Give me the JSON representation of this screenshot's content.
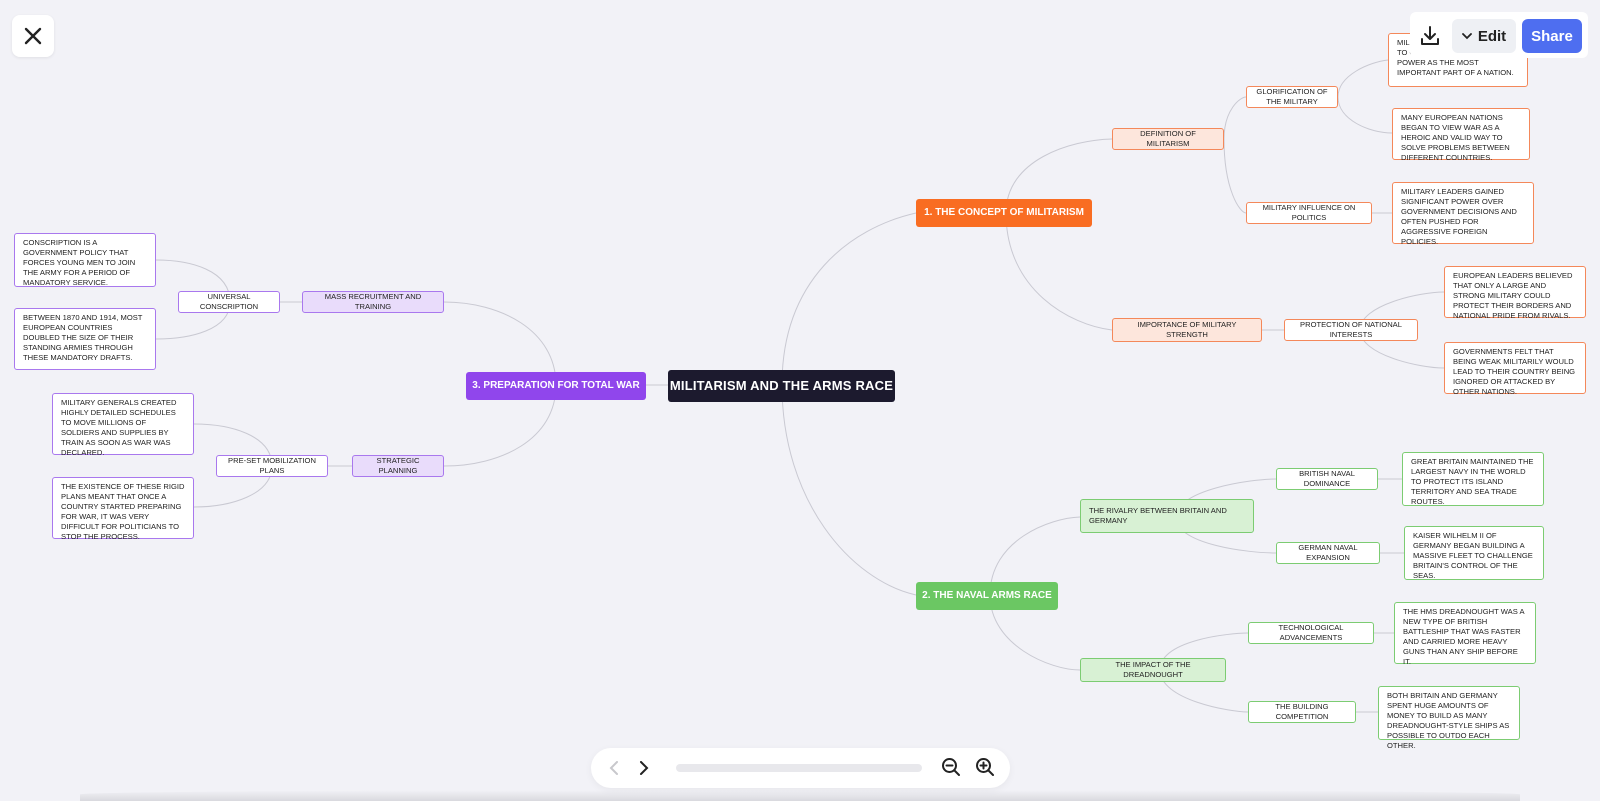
{
  "toolbar": {
    "edit_label": "Edit",
    "share_label": "Share"
  },
  "colors": {
    "orange": "#f96d22",
    "green": "#6bc763",
    "purple": "#9046ec",
    "root": "#1c1a2e",
    "share": "#4e6ef0"
  },
  "mindmap": {
    "root": "MILITARISM AND THE ARMS RACE",
    "branch1": {
      "title": "1. THE CONCEPT OF MILITARISM",
      "definition": "DEFINITION OF MILITARISM",
      "glorification": "GLORIFICATION OF THE MILITARY",
      "glorification_leaf1": "MILITARISM WAS THE ATTITUDE TO CELEBRATE MILITARY POWER AS THE MOST IMPORTANT PART OF A NATION.",
      "glorification_leaf2": "MANY EUROPEAN NATIONS BEGAN TO VIEW WAR AS A HEROIC AND VALID WAY TO SOLVE PROBLEMS BETWEEN DIFFERENT COUNTRIES.",
      "influence": "MILITARY INFLUENCE ON POLITICS",
      "influence_leaf": "MILITARY LEADERS GAINED SIGNIFICANT POWER OVER GOVERNMENT DECISIONS AND OFTEN PUSHED FOR AGGRESSIVE FOREIGN POLICIES.",
      "importance": "IMPORTANCE OF MILITARY STRENGTH",
      "protection": "PROTECTION OF NATIONAL INTERESTS",
      "protection_leaf1": "EUROPEAN LEADERS BELIEVED THAT ONLY A LARGE AND STRONG MILITARY COULD PROTECT THEIR BORDERS AND NATIONAL PRIDE FROM RIVALS.",
      "protection_leaf2": "GOVERNMENTS FELT THAT BEING WEAK MILITARILY WOULD LEAD TO THEIR COUNTRY BEING IGNORED OR ATTACKED BY OTHER NATIONS."
    },
    "branch2": {
      "title": "2. THE NAVAL ARMS RACE",
      "rivalry": "THE RIVALRY BETWEEN BRITAIN AND GERMANY",
      "british": "BRITISH NAVAL DOMINANCE",
      "british_leaf": "GREAT BRITAIN MAINTAINED THE LARGEST NAVY IN THE WORLD TO PROTECT ITS ISLAND TERRITORY AND SEA TRADE ROUTES.",
      "german": "GERMAN NAVAL EXPANSION",
      "german_leaf": "KAISER WILHELM II OF GERMANY BEGAN BUILDING A MASSIVE FLEET TO CHALLENGE BRITAIN'S CONTROL OF THE SEAS.",
      "dreadnought": "THE IMPACT OF THE DREADNOUGHT",
      "tech": "TECHNOLOGICAL ADVANCEMENTS",
      "tech_leaf": "THE HMS DREADNOUGHT WAS A NEW TYPE OF BRITISH BATTLESHIP THAT WAS FASTER AND CARRIED MORE HEAVY GUNS THAN ANY SHIP BEFORE IT.",
      "building": "THE BUILDING COMPETITION",
      "building_leaf": "BOTH BRITAIN AND GERMANY SPENT HUGE AMOUNTS OF MONEY TO BUILD AS MANY DREADNOUGHT-STYLE SHIPS AS POSSIBLE TO OUTDO EACH OTHER."
    },
    "branch3": {
      "title": "3. PREPARATION FOR TOTAL WAR",
      "mass": "MASS RECRUITMENT AND TRAINING",
      "universal": "UNIVERSAL CONSCRIPTION",
      "universal_leaf1": "CONSCRIPTION IS A GOVERNMENT POLICY THAT FORCES YOUNG MEN TO JOIN THE ARMY FOR A PERIOD OF MANDATORY SERVICE.",
      "universal_leaf2": "BETWEEN 1870 AND 1914, MOST EUROPEAN COUNTRIES DOUBLED THE SIZE OF THEIR STANDING ARMIES THROUGH THESE MANDATORY DRAFTS.",
      "strategic": "STRATEGIC PLANNING",
      "preset": "PRE-SET MOBILIZATION PLANS",
      "preset_leaf1": "MILITARY GENERALS CREATED HIGHLY DETAILED SCHEDULES TO MOVE MILLIONS OF SOLDIERS AND SUPPLIES BY TRAIN AS SOON AS WAR WAS DECLARED.",
      "preset_leaf2": "THE EXISTENCE OF THESE RIGID PLANS MEANT THAT ONCE A COUNTRY STARTED PREPARING FOR WAR, IT WAS VERY DIFFICULT FOR POLITICIANS TO STOP THE PROCESS."
    }
  }
}
